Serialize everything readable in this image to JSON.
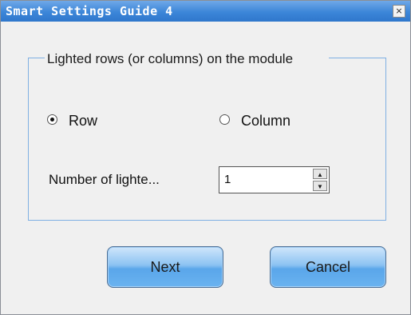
{
  "window": {
    "title": "Smart Settings Guide 4",
    "close_glyph": "×"
  },
  "group": {
    "legend": "Lighted rows (or columns) on the module",
    "options": [
      {
        "label": "Row",
        "checked": true
      },
      {
        "label": "Column",
        "checked": false
      }
    ]
  },
  "field": {
    "label": "Number of lighte...",
    "value": "1"
  },
  "buttons": {
    "next": "Next",
    "cancel": "Cancel"
  },
  "colors": {
    "titlebar": "#3c86d8",
    "group_border": "#7fb0e3",
    "button": "#6ab3f0"
  }
}
